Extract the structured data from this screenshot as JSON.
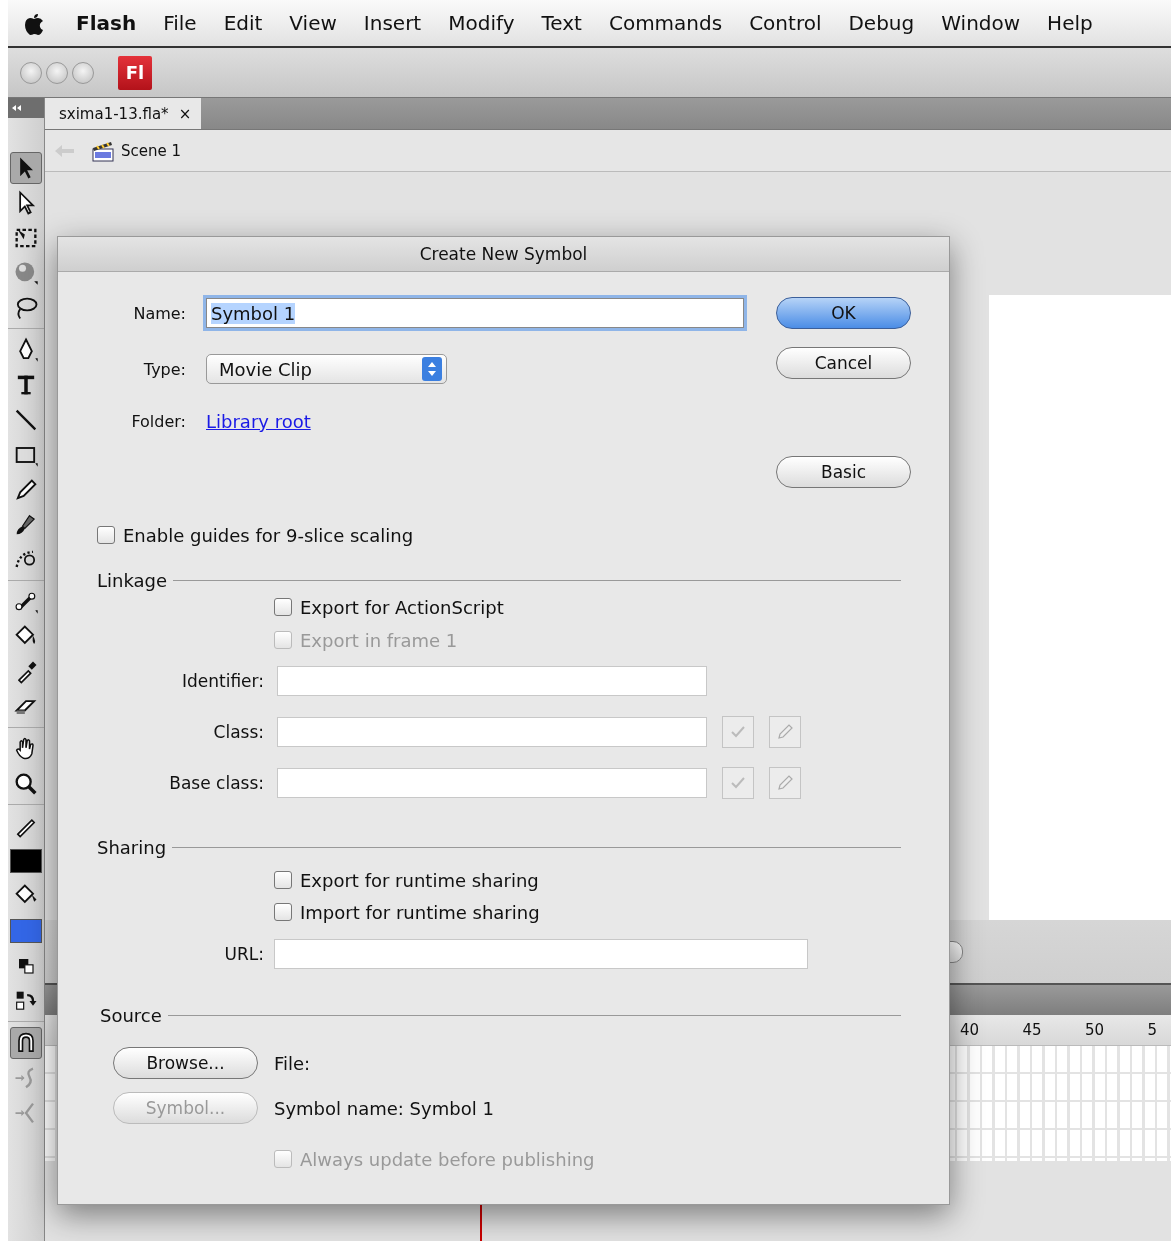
{
  "menubar": {
    "app_name": "Flash",
    "items": [
      "File",
      "Edit",
      "View",
      "Insert",
      "Modify",
      "Text",
      "Commands",
      "Control",
      "Debug",
      "Window",
      "Help"
    ]
  },
  "window": {
    "app_badge": "Fl"
  },
  "document_tab": {
    "title": "sxima1-13.fla*",
    "close": "×"
  },
  "breadcrumb": {
    "scene": "Scene 1"
  },
  "tools": [
    {
      "kind": "selection",
      "selected": true
    },
    {
      "kind": "subselection",
      "selected": false
    },
    {
      "kind": "transform",
      "selected": false
    },
    {
      "kind": "rotate3d",
      "selected": false
    },
    {
      "kind": "lasso",
      "selected": false
    },
    {
      "kind": "sep"
    },
    {
      "kind": "pen",
      "selected": false
    },
    {
      "kind": "text",
      "selected": false
    },
    {
      "kind": "line",
      "selected": false
    },
    {
      "kind": "rect",
      "selected": false
    },
    {
      "kind": "pencil",
      "selected": false
    },
    {
      "kind": "brush",
      "selected": false
    },
    {
      "kind": "deco",
      "selected": false
    },
    {
      "kind": "sep"
    },
    {
      "kind": "bone",
      "selected": false
    },
    {
      "kind": "bucket",
      "selected": false
    },
    {
      "kind": "dropper",
      "selected": false
    },
    {
      "kind": "eraser",
      "selected": false
    },
    {
      "kind": "sep"
    },
    {
      "kind": "hand",
      "selected": false
    },
    {
      "kind": "zoom",
      "selected": false
    },
    {
      "kind": "sep"
    },
    {
      "kind": "strokepen",
      "selected": false
    },
    {
      "kind": "swatch",
      "color": "#000000"
    },
    {
      "kind": "fillbucket",
      "selected": false
    },
    {
      "kind": "swatch",
      "color": "#3366e6"
    },
    {
      "kind": "defaults",
      "selected": false
    },
    {
      "kind": "swap",
      "selected": false
    },
    {
      "kind": "sep"
    },
    {
      "kind": "magnet",
      "selected": true
    },
    {
      "kind": "smooth",
      "selected": false
    },
    {
      "kind": "straighten",
      "selected": false
    }
  ],
  "timeline": {
    "ruler": [
      "40",
      "45",
      "50",
      "5"
    ]
  },
  "dialog": {
    "title": "Create New Symbol",
    "name": {
      "label": "Name:",
      "value": "Symbol 1",
      "focused": true
    },
    "type": {
      "label": "Type:",
      "value": "Movie Clip"
    },
    "folder": {
      "label": "Folder:",
      "link": "Library root"
    },
    "buttons": [
      {
        "label": "OK",
        "default": true
      },
      {
        "label": "Cancel",
        "default": false
      },
      {
        "label": "Basic",
        "default": false
      }
    ],
    "nine_slice": {
      "label": "Enable guides for 9-slice scaling",
      "checked": false
    },
    "linkage": {
      "title": "Linkage",
      "options": [
        {
          "label": "Export for ActionScript",
          "checked": false,
          "disabled": false
        },
        {
          "label": "Export in frame 1",
          "checked": false,
          "disabled": true
        }
      ],
      "fields": [
        {
          "label": "Identifier:",
          "has_buttons": false
        },
        {
          "label": "Class:",
          "has_buttons": true
        },
        {
          "label": "Base class:",
          "has_buttons": true
        }
      ]
    },
    "sharing": {
      "title": "Sharing",
      "options": [
        {
          "label": "Export for runtime sharing",
          "checked": false,
          "disabled": false
        },
        {
          "label": "Import for runtime sharing",
          "checked": false,
          "disabled": false
        }
      ],
      "url_label": "URL:"
    },
    "source": {
      "title": "Source",
      "browse": {
        "label": "Browse...",
        "disabled": false
      },
      "file_label": "File:",
      "symbol": {
        "label": "Symbol...",
        "disabled": true
      },
      "symbol_name": "Symbol name: Symbol 1",
      "always_update": {
        "label": "Always update before publishing",
        "checked": false,
        "disabled": true
      }
    }
  }
}
